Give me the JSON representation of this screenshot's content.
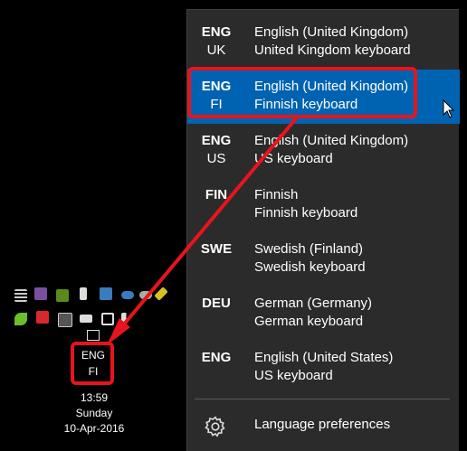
{
  "language_menu": {
    "items": [
      {
        "code": "ENG",
        "sub": "UK",
        "language": "English (United Kingdom)",
        "keyboard": "United Kingdom keyboard",
        "selected": false
      },
      {
        "code": "ENG",
        "sub": "FI",
        "language": "English (United Kingdom)",
        "keyboard": "Finnish keyboard",
        "selected": true
      },
      {
        "code": "ENG",
        "sub": "US",
        "language": "English (United Kingdom)",
        "keyboard": "US keyboard",
        "selected": false
      },
      {
        "code": "FIN",
        "sub": "",
        "language": "Finnish",
        "keyboard": "Finnish keyboard",
        "selected": false
      },
      {
        "code": "SWE",
        "sub": "",
        "language": "Swedish (Finland)",
        "keyboard": "Swedish keyboard",
        "selected": false
      },
      {
        "code": "DEU",
        "sub": "",
        "language": "German (Germany)",
        "keyboard": "German keyboard",
        "selected": false
      },
      {
        "code": "ENG",
        "sub": "",
        "language": "English (United States)",
        "keyboard": "US keyboard",
        "selected": false
      }
    ],
    "preferences_label": "Language preferences",
    "preferences_icon": "gear-icon"
  },
  "taskbar": {
    "input_indicator": {
      "code": "ENG",
      "sub": "FI"
    },
    "clock": {
      "time": "13:59",
      "day": "Sunday",
      "date": "10-Apr-2016"
    }
  },
  "colors": {
    "flyout_bg": "#2b2b2b",
    "selected_bg": "#0063b1",
    "highlight": "#e8141c"
  }
}
